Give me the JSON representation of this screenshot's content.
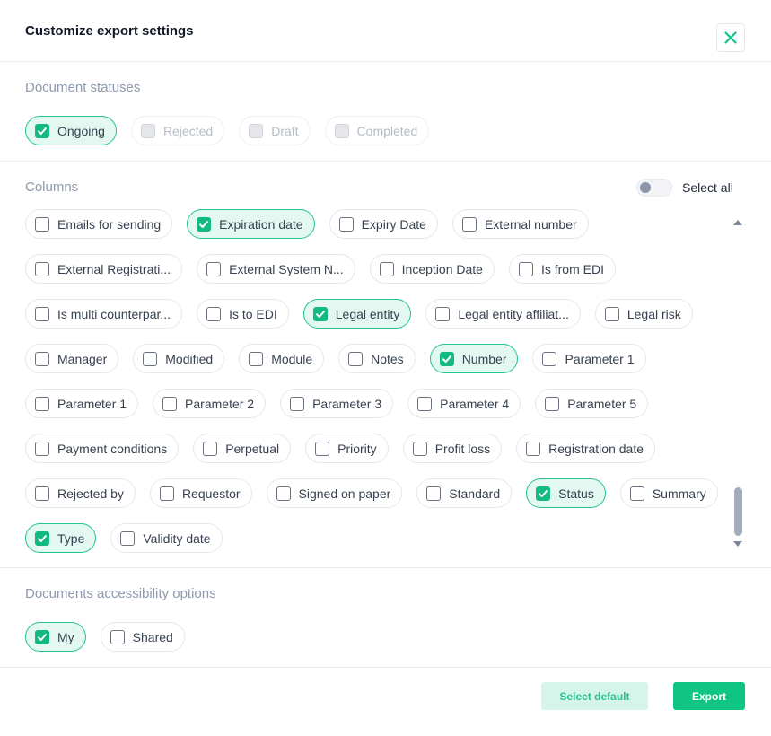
{
  "dialog": {
    "title": "Customize export settings"
  },
  "statuses": {
    "title": "Document statuses",
    "items": [
      {
        "label": "Ongoing",
        "checked": true,
        "disabled": false
      },
      {
        "label": "Rejected",
        "checked": false,
        "disabled": true
      },
      {
        "label": "Draft",
        "checked": false,
        "disabled": true
      },
      {
        "label": "Completed",
        "checked": false,
        "disabled": true
      }
    ]
  },
  "columns": {
    "title": "Columns",
    "select_all_label": "Select all",
    "select_all_on": false,
    "items": [
      {
        "label": "Emails for sending",
        "checked": false
      },
      {
        "label": "Expiration date",
        "checked": true
      },
      {
        "label": "Expiry Date",
        "checked": false
      },
      {
        "label": "External number",
        "checked": false
      },
      {
        "label": "External Registrati...",
        "checked": false
      },
      {
        "label": "External System N...",
        "checked": false
      },
      {
        "label": "Inception Date",
        "checked": false
      },
      {
        "label": "Is from EDI",
        "checked": false
      },
      {
        "label": "Is multi counterpar...",
        "checked": false
      },
      {
        "label": "Is to EDI",
        "checked": false
      },
      {
        "label": "Legal entity",
        "checked": true
      },
      {
        "label": "Legal entity affiliat...",
        "checked": false
      },
      {
        "label": "Legal risk",
        "checked": false
      },
      {
        "label": "Manager",
        "checked": false
      },
      {
        "label": "Modified",
        "checked": false
      },
      {
        "label": "Module",
        "checked": false
      },
      {
        "label": "Notes",
        "checked": false
      },
      {
        "label": "Number",
        "checked": true
      },
      {
        "label": "Parameter 1",
        "checked": false
      },
      {
        "label": "Parameter 1",
        "checked": false
      },
      {
        "label": "Parameter 2",
        "checked": false
      },
      {
        "label": "Parameter 3",
        "checked": false
      },
      {
        "label": "Parameter 4",
        "checked": false
      },
      {
        "label": "Parameter 5",
        "checked": false
      },
      {
        "label": "Payment conditions",
        "checked": false
      },
      {
        "label": "Perpetual",
        "checked": false
      },
      {
        "label": "Priority",
        "checked": false
      },
      {
        "label": "Profit loss",
        "checked": false
      },
      {
        "label": "Registration date",
        "checked": false
      },
      {
        "label": "Rejected by",
        "checked": false
      },
      {
        "label": "Requestor",
        "checked": false
      },
      {
        "label": "Signed on paper",
        "checked": false
      },
      {
        "label": "Standard",
        "checked": false
      },
      {
        "label": "Status",
        "checked": true
      },
      {
        "label": "Summary",
        "checked": false
      },
      {
        "label": "Type",
        "checked": true
      },
      {
        "label": "Validity date",
        "checked": false
      }
    ]
  },
  "accessibility": {
    "title": "Documents accessibility options",
    "items": [
      {
        "label": "My",
        "checked": true,
        "disabled": false
      },
      {
        "label": "Shared",
        "checked": false,
        "disabled": false
      }
    ]
  },
  "footer": {
    "select_default_label": "Select default",
    "export_label": "Export"
  },
  "colors": {
    "accent": "#10c483",
    "checked_bg": "#e3f8f0",
    "section_title": "#8e9aad"
  },
  "icons": {
    "close": "close-icon",
    "check": "checkmark-icon",
    "scroll_up": "triangle-up-icon",
    "scroll_down": "triangle-down-icon"
  }
}
